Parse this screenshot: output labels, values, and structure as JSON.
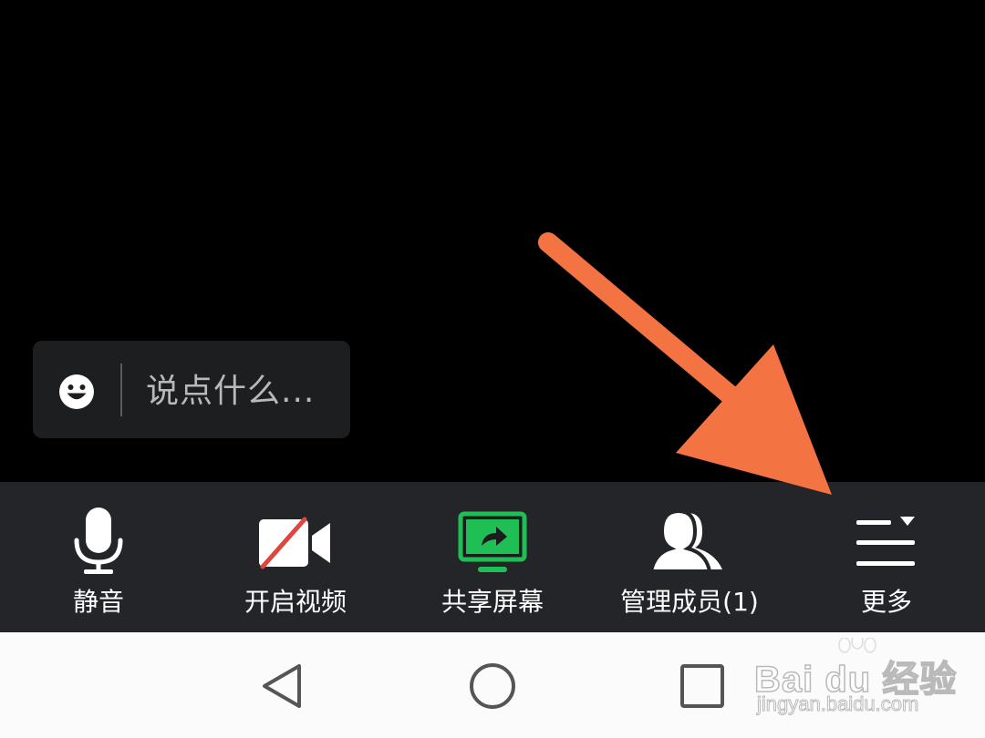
{
  "chat": {
    "placeholder": "说点什么...",
    "emoji_icon": "smiley-face-icon"
  },
  "toolbar": {
    "items": [
      {
        "label": "静音",
        "icon": "microphone-icon"
      },
      {
        "label": "开启视频",
        "icon": "video-camera-off-icon"
      },
      {
        "label": "共享屏幕",
        "icon": "share-screen-icon"
      },
      {
        "label": "管理成员(1)",
        "icon": "members-icon"
      },
      {
        "label": "更多",
        "icon": "more-menu-icon"
      }
    ]
  },
  "navigation": {
    "back_icon": "triangle-back-icon",
    "home_icon": "circle-home-icon",
    "recents_icon": "square-recents-icon"
  },
  "watermark": {
    "brand": "Bai du 经验",
    "url": "jingyan.baidu.com"
  },
  "colors": {
    "background": "#000000",
    "toolbar": "#242528",
    "chat_pill": "#1d1e20",
    "share_green": "#1fbf55",
    "video_off_red": "#e0463d",
    "arrow_orange": "#f47342",
    "navbar": "#fbfbfb"
  }
}
